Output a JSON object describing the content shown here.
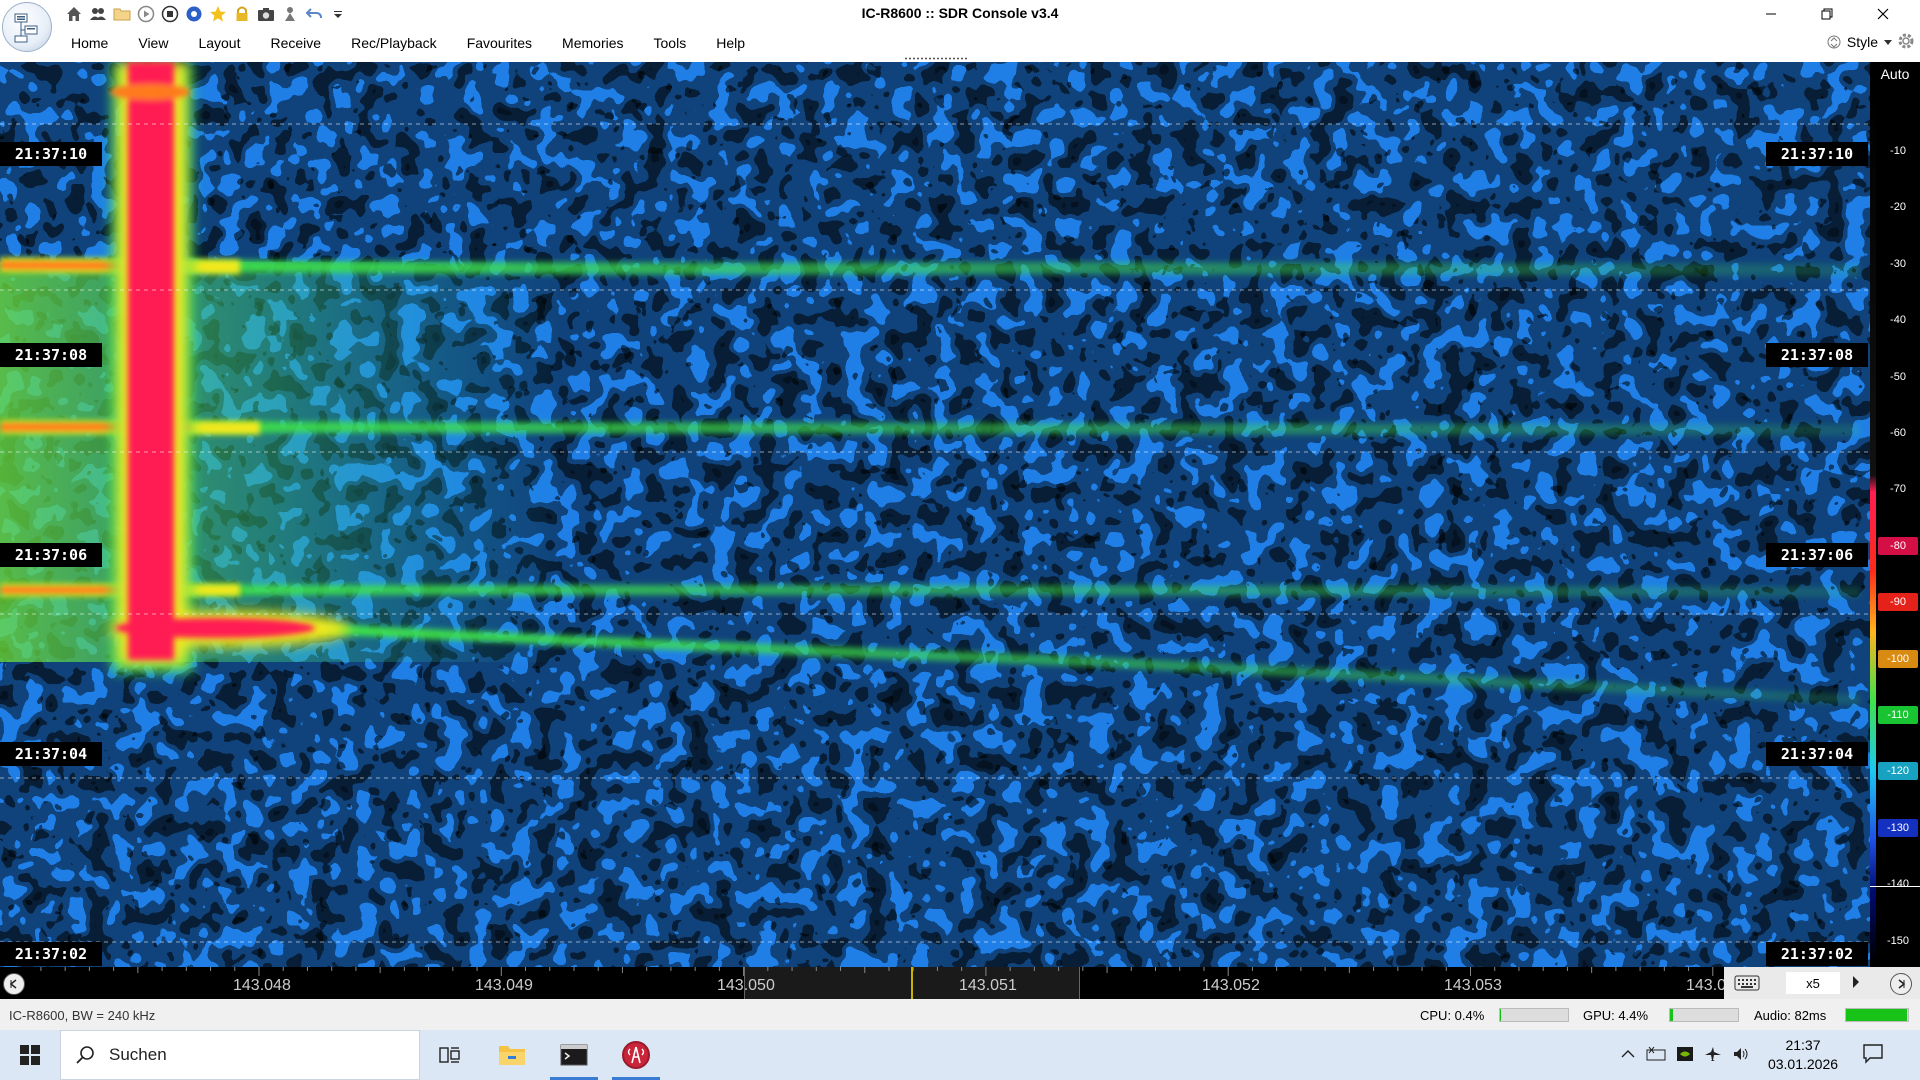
{
  "window": {
    "title": "IC-R8600 :: SDR Console v3.4",
    "minimize": "–",
    "restore": "❐",
    "close": "✕"
  },
  "quick_access": [
    {
      "name": "home-icon",
      "glyph": "⌂"
    },
    {
      "name": "users-icon",
      "glyph": "👥"
    },
    {
      "name": "folder-icon",
      "glyph": "📁"
    },
    {
      "name": "play-icon",
      "glyph": "▶"
    },
    {
      "name": "stop-icon",
      "glyph": "■"
    },
    {
      "name": "record-icon",
      "glyph": "●"
    },
    {
      "name": "star-icon",
      "glyph": "★"
    },
    {
      "name": "lock-icon",
      "glyph": "🔒"
    },
    {
      "name": "camera-icon",
      "glyph": "📷"
    },
    {
      "name": "antenna-icon",
      "glyph": "♙"
    },
    {
      "name": "undo-icon",
      "glyph": "↶"
    },
    {
      "name": "dropdown-icon",
      "glyph": "▾"
    }
  ],
  "menu": [
    "Home",
    "View",
    "Layout",
    "Receive",
    "Rec/Playback",
    "Favourites",
    "Memories",
    "Tools",
    "Help"
  ],
  "style_label": "Style",
  "waterfall": {
    "auto_label": "Auto",
    "time_labels": [
      "21:37:10",
      "21:37:08",
      "21:37:06",
      "21:37:04",
      "21:37:02"
    ],
    "colors": {
      "noise_dark": "#000a6e",
      "noise_blue": "#1f7fe6",
      "noise_cyan": "#1ec8f0",
      "signal_green": "#3ee24a",
      "signal_yellow": "#f2e81e",
      "signal_red": "#ff1e52"
    }
  },
  "db_scale": {
    "ticks": [
      "-10",
      "-20",
      "-30",
      "-40",
      "-50",
      "-60",
      "-70",
      "-80",
      "-90",
      "-100",
      "-110",
      "-120",
      "-130",
      "-140",
      "-150"
    ],
    "colored_ticks": {
      "-80": "#d40f46",
      "-90": "#e52219",
      "-100": "#d98a10",
      "-110": "#19c432",
      "-120": "#18a2c2",
      "-130": "#1430c0"
    }
  },
  "frequency_scale": {
    "labels": [
      "143.048",
      "143.049",
      "143.050",
      "143.051",
      "143.052",
      "143.053",
      "143.0"
    ],
    "zoom": "x5"
  },
  "status": {
    "device": "IC-R8600, BW = 240 kHz",
    "cpu": "CPU: 0.4%",
    "cpu_fraction": 0.004,
    "gpu": "GPU: 4.4%",
    "gpu_fraction": 0.044,
    "audio": "Audio: 82ms",
    "audio_fraction": 0.98
  },
  "taskbar": {
    "search_placeholder": "Suchen",
    "time": "21:37",
    "date": "03.01.2026"
  }
}
